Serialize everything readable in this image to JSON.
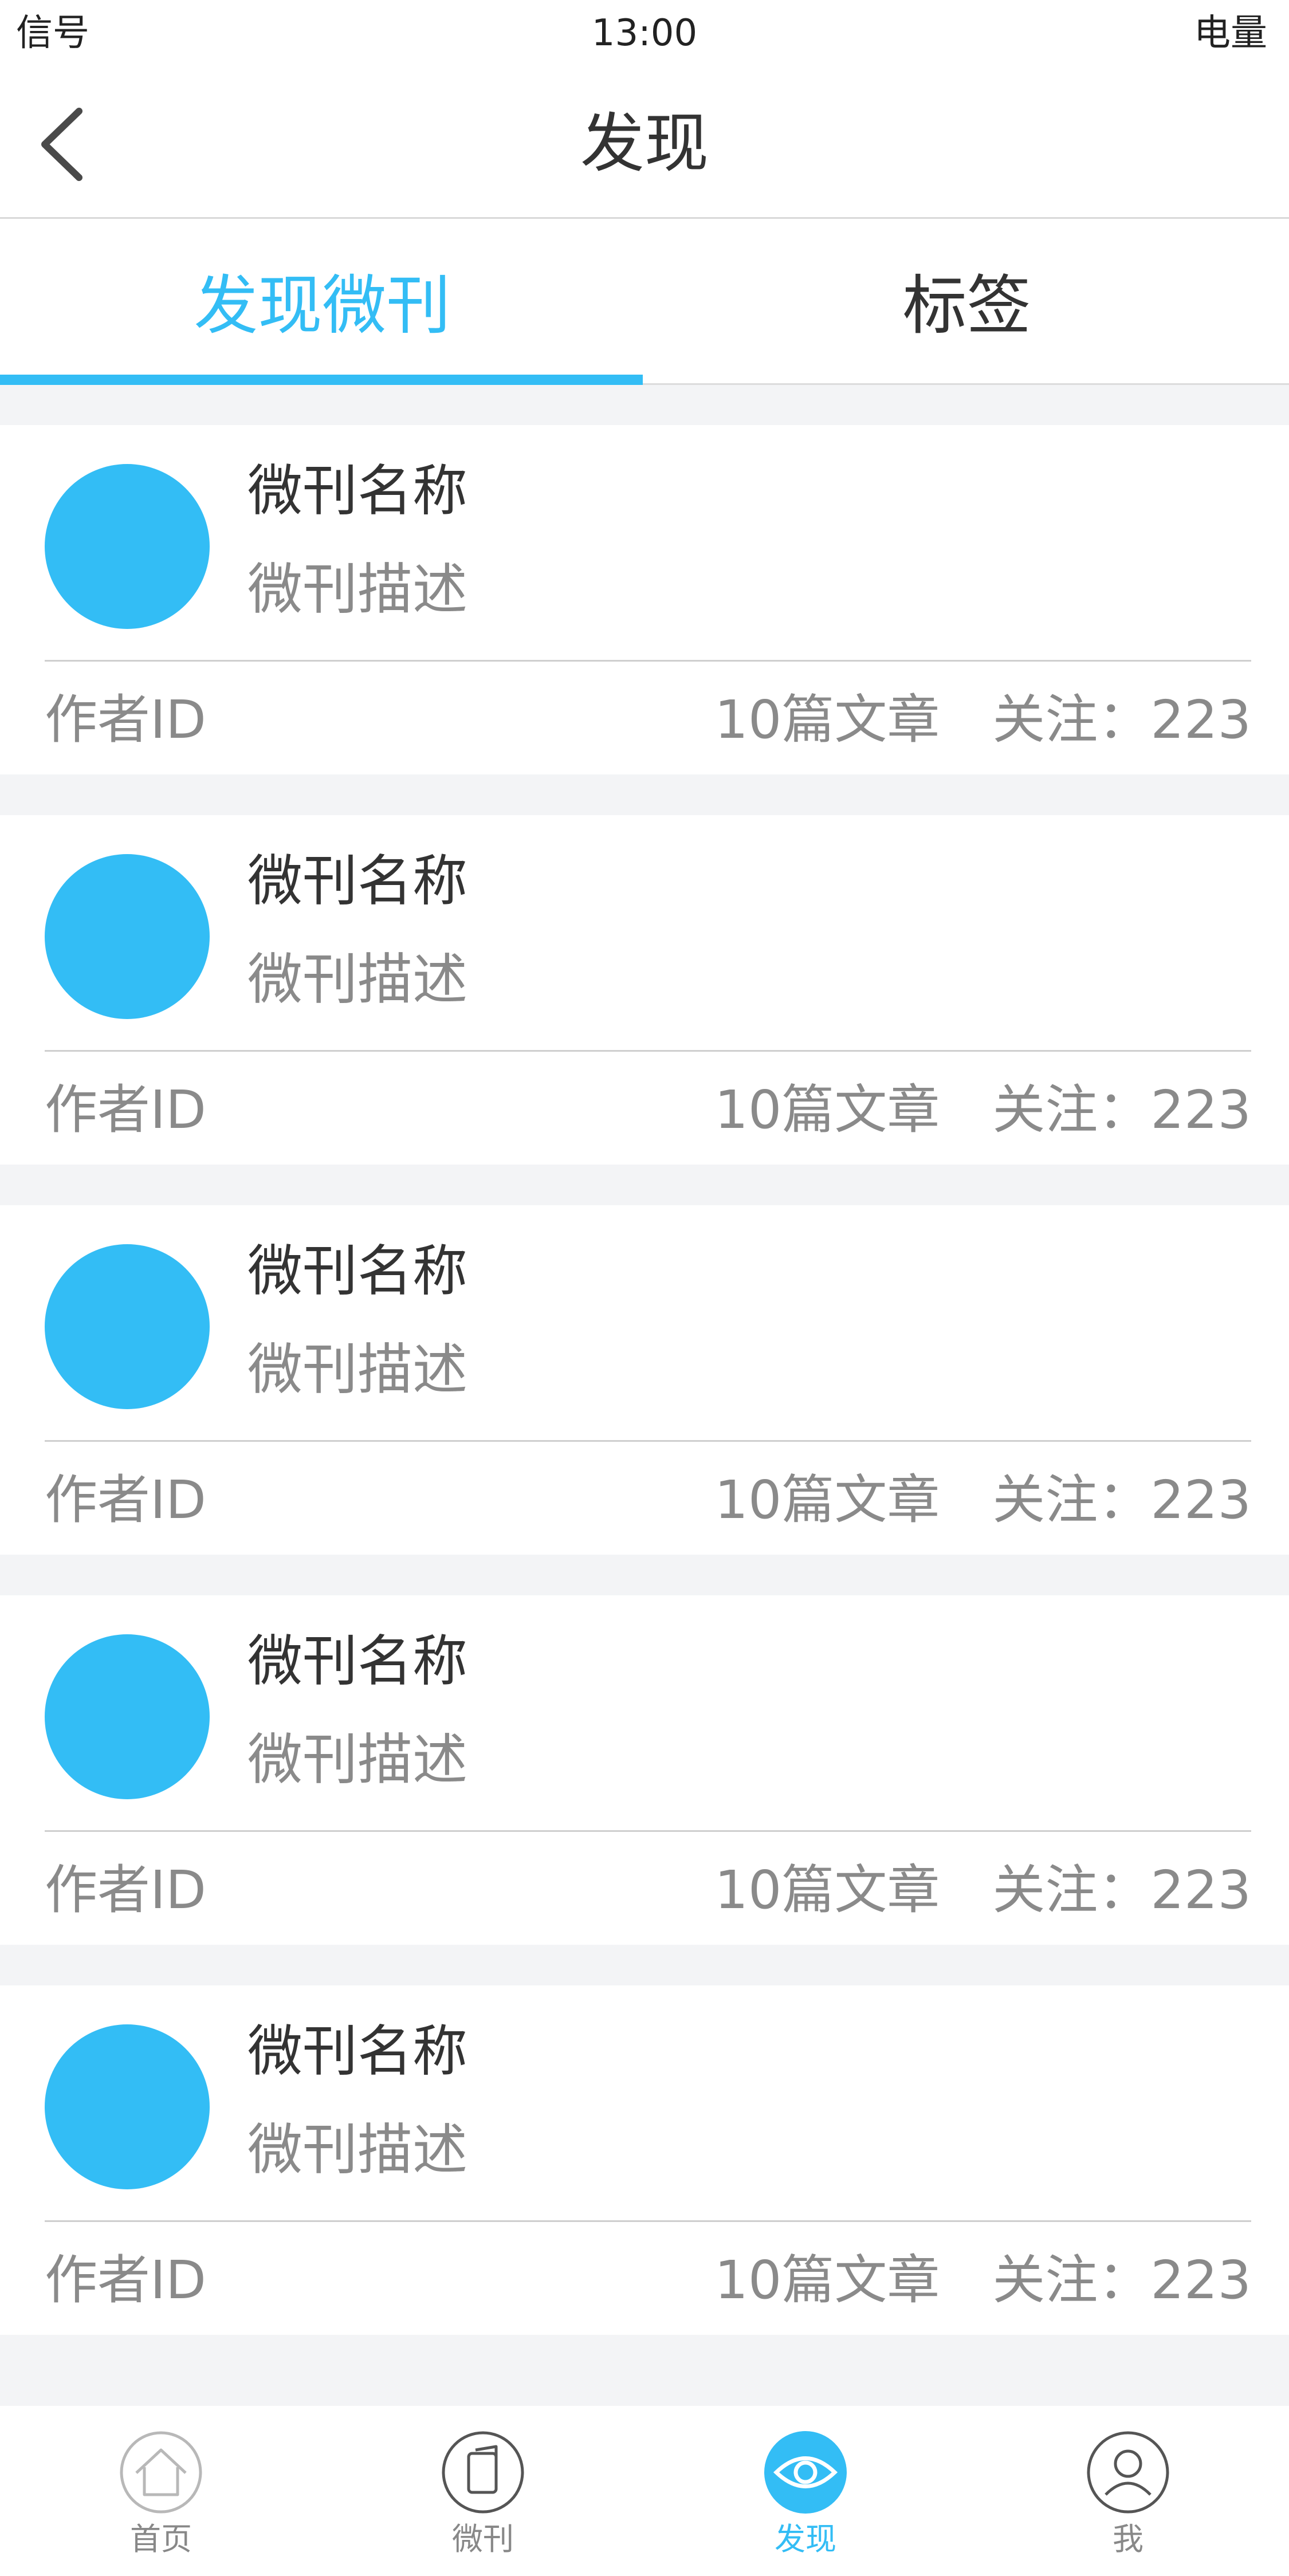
{
  "status_bar": {
    "signal": "信号",
    "time": "13:00",
    "battery": "电量"
  },
  "nav": {
    "title": "发现",
    "back_icon": "chevron-left-icon"
  },
  "tabs": [
    {
      "label": "发现微刊",
      "active": true
    },
    {
      "label": "标签",
      "active": false
    }
  ],
  "colors": {
    "accent": "#33bdf5",
    "text_primary": "#333333",
    "text_secondary": "#8a8a8a",
    "background": "#f3f4f6"
  },
  "cards": [
    {
      "title": "微刊名称",
      "description": "微刊描述",
      "author": "作者ID",
      "articles": "10篇文章",
      "followers": "关注：223"
    },
    {
      "title": "微刊名称",
      "description": "微刊描述",
      "author": "作者ID",
      "articles": "10篇文章",
      "followers": "关注：223"
    },
    {
      "title": "微刊名称",
      "description": "微刊描述",
      "author": "作者ID",
      "articles": "10篇文章",
      "followers": "关注：223"
    },
    {
      "title": "微刊名称",
      "description": "微刊描述",
      "author": "作者ID",
      "articles": "10篇文章",
      "followers": "关注：223"
    },
    {
      "title": "微刊名称",
      "description": "微刊描述",
      "author": "作者ID",
      "articles": "10篇文章",
      "followers": "关注：223"
    }
  ],
  "bottom_nav": [
    {
      "label": "首页",
      "icon": "home-icon",
      "active": false
    },
    {
      "label": "微刊",
      "icon": "book-icon",
      "active": false
    },
    {
      "label": "发现",
      "icon": "eye-icon",
      "active": true
    },
    {
      "label": "我",
      "icon": "user-icon",
      "active": false
    }
  ]
}
